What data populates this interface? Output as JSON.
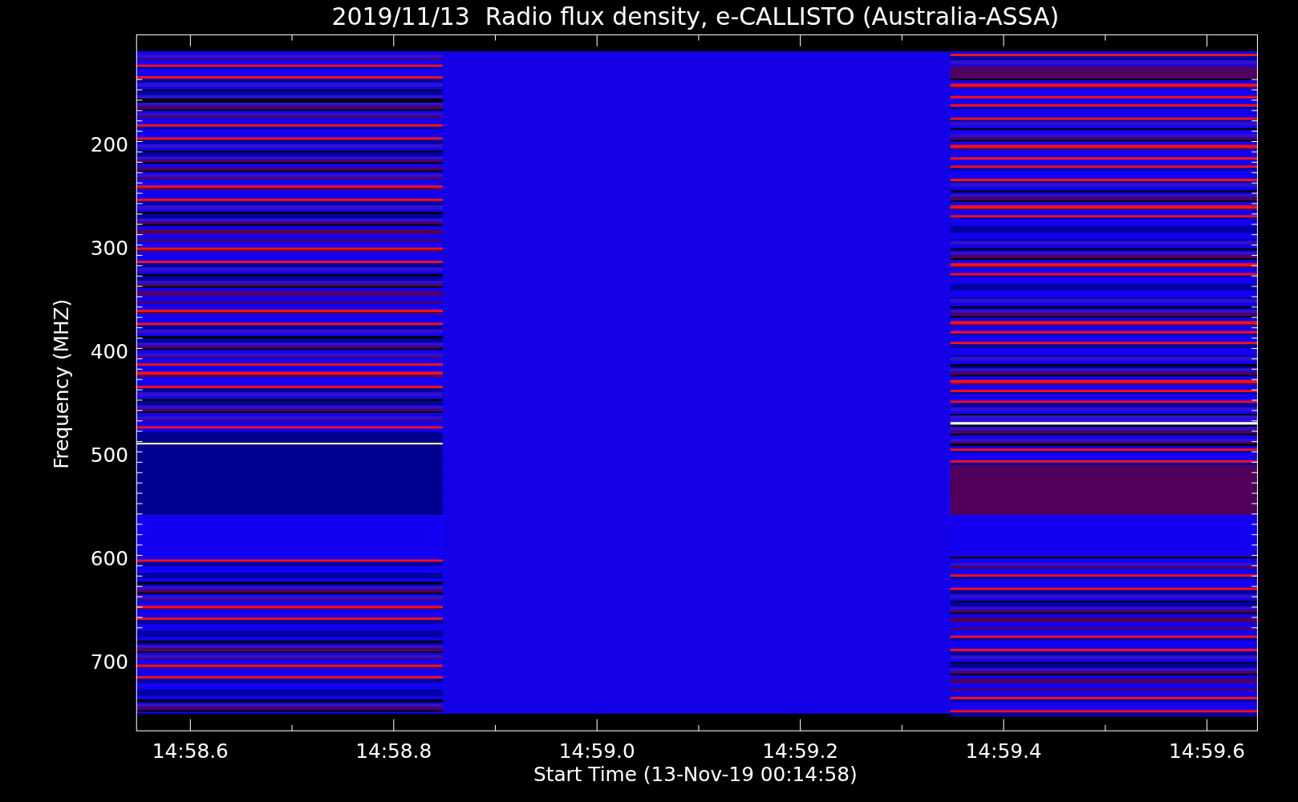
{
  "title": "2019/11/13  Radio flux density, e-CALLISTO (Australia-ASSA)",
  "y_axis": {
    "label": "Frequency (MHZ)",
    "ticks": [
      "200",
      "300",
      "400",
      "500",
      "600",
      "700"
    ]
  },
  "x_axis": {
    "label": "Start Time (13-Nov-19 00:14:58)",
    "ticks": [
      "14:58.6",
      "14:58.8",
      "14:59.0",
      "14:59.2",
      "14:59.4",
      "14:59.6"
    ]
  }
}
